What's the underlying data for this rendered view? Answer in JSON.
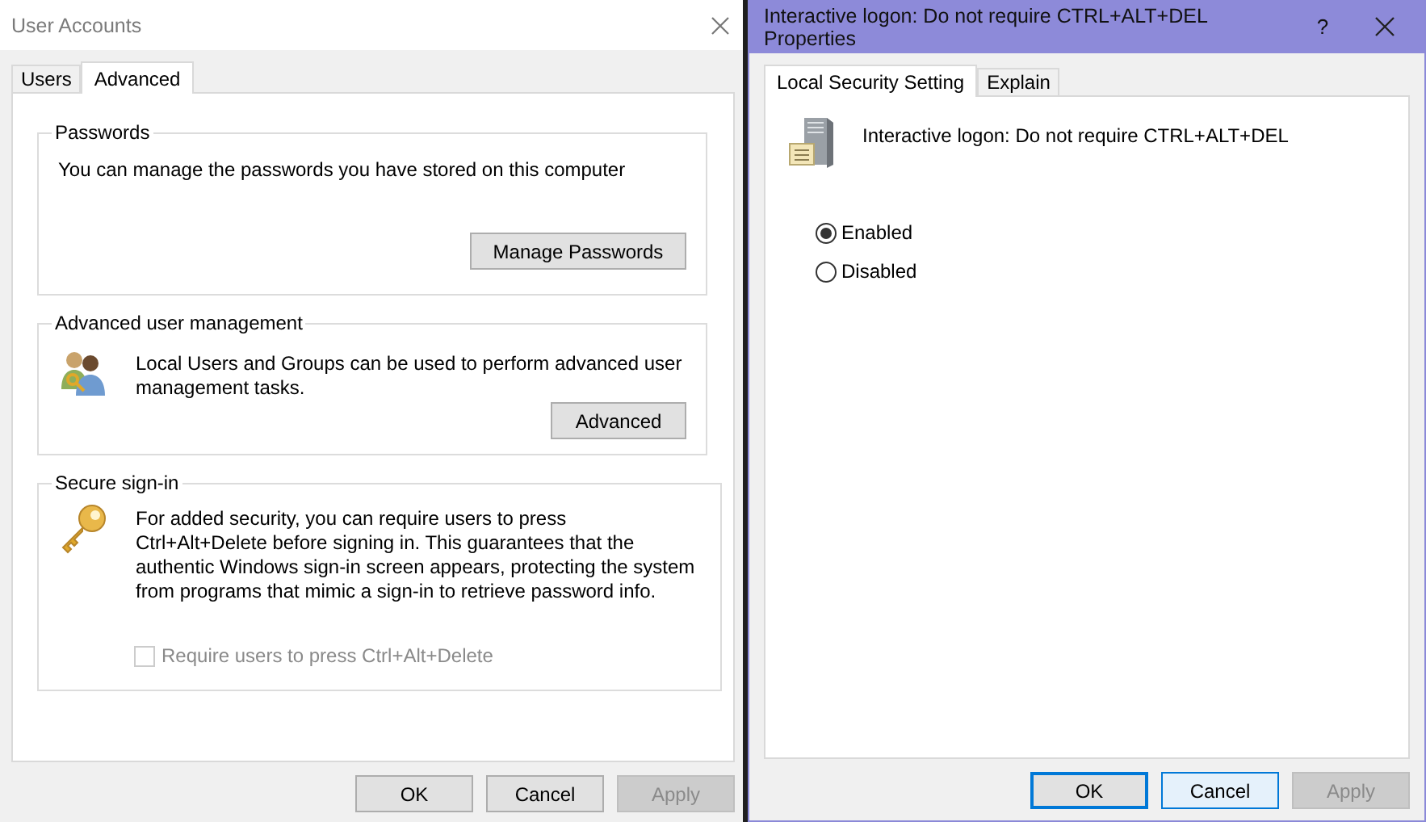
{
  "user_accounts": {
    "title": "User Accounts",
    "tabs": [
      {
        "label": "Users",
        "selected": false
      },
      {
        "label": "Advanced",
        "selected": true
      }
    ],
    "passwords": {
      "legend": "Passwords",
      "text": "You can manage the passwords you have stored on this computer",
      "button": "Manage Passwords"
    },
    "advanced_user_management": {
      "legend": "Advanced user management",
      "text": "Local Users and Groups can be used to perform advanced user management tasks.",
      "button": "Advanced"
    },
    "secure_sign_in": {
      "legend": "Secure sign-in",
      "text": "For added security, you can require users to press Ctrl+Alt+Delete before signing in. This guarantees that the authentic Windows sign-in screen appears, protecting the system from programs that mimic a sign-in to retrieve password info.",
      "checkbox": {
        "label": "Require users to press Ctrl+Alt+Delete",
        "checked": false,
        "disabled": true
      }
    },
    "buttons": [
      {
        "label": "OK",
        "disabled": false,
        "focused": false,
        "hovered": false
      },
      {
        "label": "Cancel",
        "disabled": false,
        "focused": false,
        "hovered": false
      },
      {
        "label": "Apply",
        "disabled": true,
        "focused": false,
        "hovered": false
      }
    ]
  },
  "properties": {
    "title": "Interactive logon: Do not require CTRL+ALT+DEL Properties",
    "help": "?",
    "tabs": [
      {
        "label": "Local Security Setting",
        "selected": true
      },
      {
        "label": "Explain",
        "selected": false
      }
    ],
    "policy_name": "Interactive logon: Do not require CTRL+ALT+DEL",
    "options": [
      {
        "label": "Enabled",
        "selected": true
      },
      {
        "label": "Disabled",
        "selected": false
      }
    ],
    "buttons": [
      {
        "label": "OK",
        "disabled": false,
        "focused": true,
        "hovered": false
      },
      {
        "label": "Cancel",
        "disabled": false,
        "focused": false,
        "hovered": true
      },
      {
        "label": "Apply",
        "disabled": true,
        "focused": false,
        "hovered": false
      }
    ]
  }
}
